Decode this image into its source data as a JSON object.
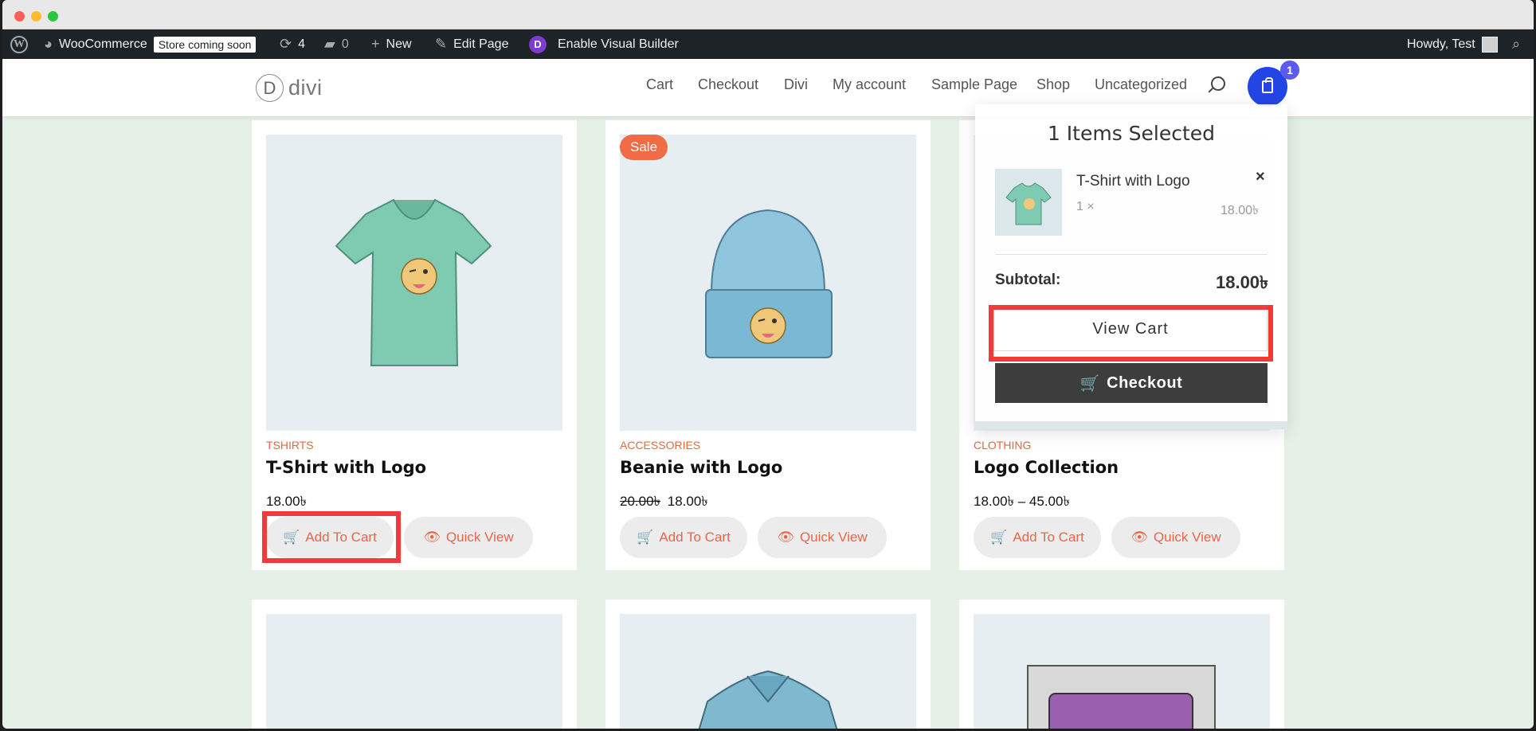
{
  "adminbar": {
    "site_name": "WooCommerce",
    "store_badge": "Store coming soon",
    "updates_count": "4",
    "comments_count": "0",
    "new_label": "New",
    "edit_label": "Edit Page",
    "builder_label": "Enable Visual Builder",
    "builder_letter": "D",
    "greeting": "Howdy, Test"
  },
  "header": {
    "logo_letter": "D",
    "logo_text": "divi",
    "nav": [
      "Cart",
      "Checkout",
      "Divi",
      "My account",
      "Sample Page",
      "Shop",
      "Uncategorized"
    ],
    "cart_count": "1"
  },
  "products": [
    {
      "category": "TSHIRTS",
      "name": "T-Shirt with Logo",
      "price": "18.00৳",
      "old_price": "",
      "sale": false,
      "add_label": "Add To Cart",
      "quick_label": "Quick View"
    },
    {
      "category": "ACCESSORIES",
      "name": "Beanie with Logo",
      "price": "18.00৳",
      "old_price": "20.00৳",
      "sale": true,
      "add_label": "Add To Cart",
      "quick_label": "Quick View"
    },
    {
      "category": "CLOTHING",
      "name": "Logo Collection",
      "price": "18.00৳  – 45.00৳",
      "old_price": "",
      "sale": true,
      "add_label": "Add To Cart",
      "quick_label": "Quick View"
    }
  ],
  "sale_label": "Sale",
  "minicart": {
    "title": "1 Items Selected",
    "item_name": "T-Shirt with Logo",
    "item_qty": "1 ×",
    "item_price": "18.00৳",
    "close": "×",
    "subtotal_label": "Subtotal:",
    "subtotal_value": "18.00৳",
    "view_cart": "View Cart",
    "checkout": "Checkout"
  },
  "colors": {
    "accent": "#f06c46",
    "cart_button": "#2445e6",
    "highlight": "#f23a3a",
    "page_bg": "#e5f1e6",
    "adminbar_bg": "#1d2327"
  }
}
